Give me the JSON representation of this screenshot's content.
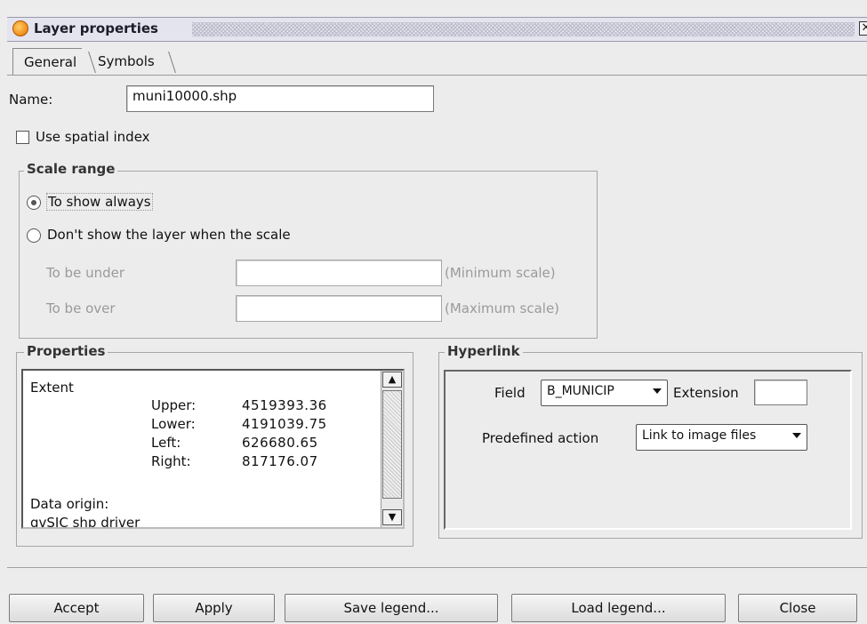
{
  "window": {
    "title": "Layer properties",
    "close_glyph": "✕"
  },
  "tabs": [
    {
      "label": "General",
      "active": true
    },
    {
      "label": "Symbols",
      "active": false
    }
  ],
  "general": {
    "name_label": "Name:",
    "name_value": "muni10000.shp",
    "spatial_index_label": "Use spatial index",
    "spatial_index_checked": false
  },
  "scale_range": {
    "title": "Scale range",
    "option_always": "To show always",
    "option_scale": "Don't show the layer when the scale",
    "selected": "always",
    "under_label": "To be under",
    "under_value": "",
    "under_hint": "(Minimum scale)",
    "over_label": "To be over",
    "over_value": "",
    "over_hint": "(Maximum scale)"
  },
  "properties": {
    "title": "Properties",
    "extent_label": "Extent",
    "rows": [
      {
        "label": "Upper:",
        "value": "4519393.36"
      },
      {
        "label": "Lower:",
        "value": "4191039.75"
      },
      {
        "label": "Left:",
        "value": "626680.65"
      },
      {
        "label": "Right:",
        "value": "817176.07"
      }
    ],
    "origin_label": "Data origin:",
    "origin_value": "gvSIC shp driver"
  },
  "hyperlink": {
    "title": "Hyperlink",
    "field_label": "Field",
    "field_value": "B_MUNICIP",
    "extension_label": "Extension",
    "extension_value": "",
    "action_label": "Predefined action",
    "action_value": "Link to image files"
  },
  "buttons": {
    "accept": "Accept",
    "apply": "Apply",
    "save_legend": "Save legend...",
    "load_legend": "Load legend...",
    "close": "Close"
  },
  "colors": {
    "window_bg": "#ececec",
    "title_bar": "#e4e4ee",
    "disabled_text": "#9a9a9a"
  }
}
